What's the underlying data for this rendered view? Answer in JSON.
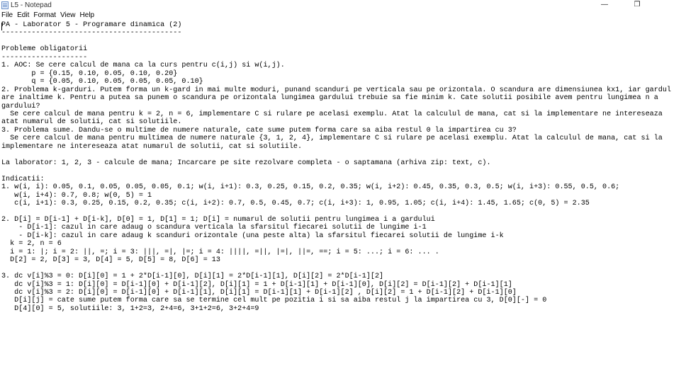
{
  "window": {
    "title": "L5 - Notepad",
    "minimize_glyph": "—",
    "maximize_glyph": "❐",
    "close_glyph": ""
  },
  "menu": [
    "File",
    "Edit",
    "Format",
    "View",
    "Help"
  ],
  "document": {
    "lines": [
      "PA - Laborator 5 - Programare dinamica (2)",
      "------------------------------------------",
      "",
      "Probleme obligatorii",
      "--------------------",
      "1. AOC: Se cere calcul de mana ca la curs pentru c(i,j) si w(i,j).",
      "       p = {0.15, 0.10, 0.05, 0.10, 0.20}",
      "       q = {0.05, 0.10, 0.05, 0.05, 0.05, 0.10}",
      "2. Problema k-garduri. Putem forma un k-gard in mai multe moduri, punand scanduri pe verticala sau pe orizontala. O scandura are dimensiunea kx1, iar gardul",
      "are inaltime k. Pentru a putea sa punem o scandura pe orizontala lungimea gardului trebuie sa fie minim k. Cate solutii posibile avem pentru lungimea n a",
      "gardului?",
      "  Se cere calcul de mana pentru k = 2, n = 6, implementare C si rulare pe acelasi exemplu. Atat la calculul de mana, cat si la implementare ne intereseaza",
      "atat numarul de solutii, cat si solutiile.",
      "3. Problema sume. Dandu-se o multime de numere naturale, cate sume putem forma care sa aiba restul 0 la impartirea cu 3?",
      "  Se cere calcul de mana pentru multimea de numere naturale {3, 1, 2, 4}, implementare C si rulare pe acelasi exemplu. Atat la calculul de mana, cat si la",
      "implementare ne intereseaza atat numarul de solutii, cat si solutiile.",
      "",
      "La laborator: 1, 2, 3 - calcule de mana; Incarcare pe site rezolvare completa - o saptamana (arhiva zip: text, c).",
      "",
      "Indicatii:",
      "1. w(i, i): 0.05, 0.1, 0.05, 0.05, 0.05, 0.1; w(i, i+1): 0.3, 0.25, 0.15, 0.2, 0.35; w(i, i+2): 0.45, 0.35, 0.3, 0.5; w(i, i+3): 0.55, 0.5, 0.6;",
      "   w(i, i+4): 0.7, 0.8; w(0, 5) = 1",
      "   c(i, i+1): 0.3, 0.25, 0.15, 0.2, 0.35; c(i, i+2): 0.7, 0.5, 0.45, 0.7; c(i, i+3): 1, 0.95, 1.05; c(i, i+4): 1.45, 1.65; c(0, 5) = 2.35",
      "",
      "2. D[i] = D[i-1] + D[i-k], D[0] = 1, D[1] = 1; D[i] = numarul de solutii pentru lungimea i a gardului",
      "    - D[i-1]: cazul in care adaug o scandura verticala la sfarsitul fiecarei solutii de lungime i-1",
      "    - D[i-k]: cazul in care adaug k scanduri orizontale (una peste alta) la sfarsitul fiecarei solutii de lungime i-k",
      "  k = 2, n = 6",
      "  i = 1: |; i = 2: ||, =; i = 3: |||, =|, |=; i = 4: ||||, =||, |=|, ||=, ==; i = 5: ...; i = 6: ... .",
      "  D[2] = 2, D[3] = 3, D[4] = 5, D[5] = 8, D[6] = 13",
      "",
      "3. dc v[i]%3 = 0: D[i][0] = 1 + 2*D[i-1][0], D[i][1] = 2*D[i-1][1], D[i][2] = 2*D[i-1][2]",
      "   dc v[i]%3 = 1: D[i][0] = D[i-1][0] + D[i-1][2], D[i][1] = 1 + D[i-1][1] + D[i-1][0], D[i][2] = D[i-1][2] + D[i-1][1]",
      "   dc v[i]%3 = 2: D[i][0] = D[i-1][0] + D[i-1][1], D[i][1] = D[i-1][1] + D[i-1][2] , D[i][2] = 1 + D[i-1][2] + D[i-1][0]",
      "   D[i][j] = cate sume putem forma care sa se termine cel mult pe pozitia i si sa aiba restul j la impartirea cu 3, D[0][-] = 0",
      "   D[4][0] = 5, solutiile: 3, 1+2=3, 2+4=6, 3+1+2=6, 3+2+4=9"
    ]
  }
}
